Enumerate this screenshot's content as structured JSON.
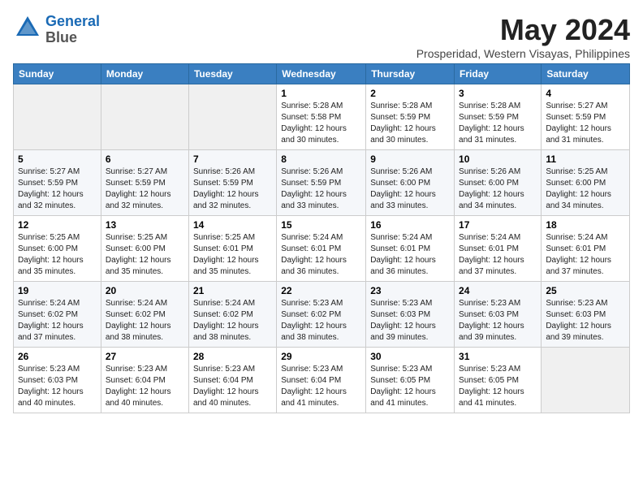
{
  "logo": {
    "line1": "General",
    "line2": "Blue"
  },
  "title": "May 2024",
  "subtitle": "Prosperidad, Western Visayas, Philippines",
  "days_header": [
    "Sunday",
    "Monday",
    "Tuesday",
    "Wednesday",
    "Thursday",
    "Friday",
    "Saturday"
  ],
  "weeks": [
    [
      {
        "day": "",
        "info": ""
      },
      {
        "day": "",
        "info": ""
      },
      {
        "day": "",
        "info": ""
      },
      {
        "day": "1",
        "info": "Sunrise: 5:28 AM\nSunset: 5:58 PM\nDaylight: 12 hours\nand 30 minutes."
      },
      {
        "day": "2",
        "info": "Sunrise: 5:28 AM\nSunset: 5:59 PM\nDaylight: 12 hours\nand 30 minutes."
      },
      {
        "day": "3",
        "info": "Sunrise: 5:28 AM\nSunset: 5:59 PM\nDaylight: 12 hours\nand 31 minutes."
      },
      {
        "day": "4",
        "info": "Sunrise: 5:27 AM\nSunset: 5:59 PM\nDaylight: 12 hours\nand 31 minutes."
      }
    ],
    [
      {
        "day": "5",
        "info": "Sunrise: 5:27 AM\nSunset: 5:59 PM\nDaylight: 12 hours\nand 32 minutes."
      },
      {
        "day": "6",
        "info": "Sunrise: 5:27 AM\nSunset: 5:59 PM\nDaylight: 12 hours\nand 32 minutes."
      },
      {
        "day": "7",
        "info": "Sunrise: 5:26 AM\nSunset: 5:59 PM\nDaylight: 12 hours\nand 32 minutes."
      },
      {
        "day": "8",
        "info": "Sunrise: 5:26 AM\nSunset: 5:59 PM\nDaylight: 12 hours\nand 33 minutes."
      },
      {
        "day": "9",
        "info": "Sunrise: 5:26 AM\nSunset: 6:00 PM\nDaylight: 12 hours\nand 33 minutes."
      },
      {
        "day": "10",
        "info": "Sunrise: 5:26 AM\nSunset: 6:00 PM\nDaylight: 12 hours\nand 34 minutes."
      },
      {
        "day": "11",
        "info": "Sunrise: 5:25 AM\nSunset: 6:00 PM\nDaylight: 12 hours\nand 34 minutes."
      }
    ],
    [
      {
        "day": "12",
        "info": "Sunrise: 5:25 AM\nSunset: 6:00 PM\nDaylight: 12 hours\nand 35 minutes."
      },
      {
        "day": "13",
        "info": "Sunrise: 5:25 AM\nSunset: 6:00 PM\nDaylight: 12 hours\nand 35 minutes."
      },
      {
        "day": "14",
        "info": "Sunrise: 5:25 AM\nSunset: 6:01 PM\nDaylight: 12 hours\nand 35 minutes."
      },
      {
        "day": "15",
        "info": "Sunrise: 5:24 AM\nSunset: 6:01 PM\nDaylight: 12 hours\nand 36 minutes."
      },
      {
        "day": "16",
        "info": "Sunrise: 5:24 AM\nSunset: 6:01 PM\nDaylight: 12 hours\nand 36 minutes."
      },
      {
        "day": "17",
        "info": "Sunrise: 5:24 AM\nSunset: 6:01 PM\nDaylight: 12 hours\nand 37 minutes."
      },
      {
        "day": "18",
        "info": "Sunrise: 5:24 AM\nSunset: 6:01 PM\nDaylight: 12 hours\nand 37 minutes."
      }
    ],
    [
      {
        "day": "19",
        "info": "Sunrise: 5:24 AM\nSunset: 6:02 PM\nDaylight: 12 hours\nand 37 minutes."
      },
      {
        "day": "20",
        "info": "Sunrise: 5:24 AM\nSunset: 6:02 PM\nDaylight: 12 hours\nand 38 minutes."
      },
      {
        "day": "21",
        "info": "Sunrise: 5:24 AM\nSunset: 6:02 PM\nDaylight: 12 hours\nand 38 minutes."
      },
      {
        "day": "22",
        "info": "Sunrise: 5:23 AM\nSunset: 6:02 PM\nDaylight: 12 hours\nand 38 minutes."
      },
      {
        "day": "23",
        "info": "Sunrise: 5:23 AM\nSunset: 6:03 PM\nDaylight: 12 hours\nand 39 minutes."
      },
      {
        "day": "24",
        "info": "Sunrise: 5:23 AM\nSunset: 6:03 PM\nDaylight: 12 hours\nand 39 minutes."
      },
      {
        "day": "25",
        "info": "Sunrise: 5:23 AM\nSunset: 6:03 PM\nDaylight: 12 hours\nand 39 minutes."
      }
    ],
    [
      {
        "day": "26",
        "info": "Sunrise: 5:23 AM\nSunset: 6:03 PM\nDaylight: 12 hours\nand 40 minutes."
      },
      {
        "day": "27",
        "info": "Sunrise: 5:23 AM\nSunset: 6:04 PM\nDaylight: 12 hours\nand 40 minutes."
      },
      {
        "day": "28",
        "info": "Sunrise: 5:23 AM\nSunset: 6:04 PM\nDaylight: 12 hours\nand 40 minutes."
      },
      {
        "day": "29",
        "info": "Sunrise: 5:23 AM\nSunset: 6:04 PM\nDaylight: 12 hours\nand 41 minutes."
      },
      {
        "day": "30",
        "info": "Sunrise: 5:23 AM\nSunset: 6:05 PM\nDaylight: 12 hours\nand 41 minutes."
      },
      {
        "day": "31",
        "info": "Sunrise: 5:23 AM\nSunset: 6:05 PM\nDaylight: 12 hours\nand 41 minutes."
      },
      {
        "day": "",
        "info": ""
      }
    ]
  ]
}
